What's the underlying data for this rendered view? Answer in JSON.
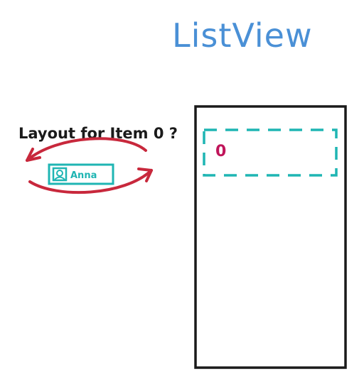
{
  "title": "ListView",
  "question": "Layout for Item 0 ?",
  "layout_preview": {
    "name_label": "Anna",
    "icon": "person-icon"
  },
  "list_view": {
    "first_item_label": "0"
  },
  "colors": {
    "title": "#4a90d6",
    "arrows": "#c8283c",
    "teal": "#1fb5b3",
    "item_index": "#c0155a",
    "ink": "#1a1a1a"
  }
}
